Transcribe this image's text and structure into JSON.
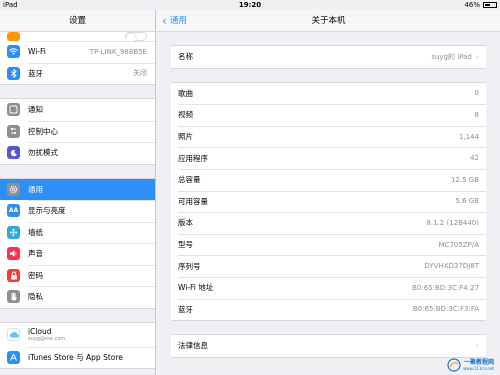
{
  "status_bar": {
    "device": "iPad",
    "time": "19:20",
    "battery": "46%",
    "battery_level": 0.46
  },
  "sidebar": {
    "title": "设置",
    "group1": [
      {
        "label": "Wi-Fi",
        "value": "TP-LINK_988B5E",
        "icon": "wifi-icon",
        "color": "#2d8ff6"
      },
      {
        "label": "蓝牙",
        "value": "关闭",
        "icon": "bluetooth-icon",
        "color": "#2d8ff6"
      }
    ],
    "group2": [
      {
        "label": "通知",
        "icon": "notification-icon",
        "color": "#8e8e93"
      },
      {
        "label": "控制中心",
        "icon": "control-center-icon",
        "color": "#8e8e93"
      },
      {
        "label": "勿扰模式",
        "icon": "do-not-disturb-icon",
        "color": "#5856d6"
      }
    ],
    "group3": [
      {
        "label": "通用",
        "icon": "gear-icon",
        "color": "#8e8e93",
        "selected": true
      },
      {
        "label": "显示与亮度",
        "icon": "brightness-icon",
        "color": "#2d8ff6"
      },
      {
        "label": "墙纸",
        "icon": "wallpaper-icon",
        "color": "#34aadc"
      },
      {
        "label": "声音",
        "icon": "sound-icon",
        "color": "#ff2d55"
      },
      {
        "label": "密码",
        "icon": "lock-icon",
        "color": "#ff3b30"
      },
      {
        "label": "隐私",
        "icon": "privacy-hand-icon",
        "color": "#8e8e93"
      }
    ],
    "group4": [
      {
        "label": "iCloud",
        "sub": "suyg@me.com",
        "icon": "icloud-icon",
        "color": "#ffffff"
      },
      {
        "label": "iTunes Store 与 App Store",
        "icon": "app-store-icon",
        "color": "#2d8ff6"
      }
    ]
  },
  "main": {
    "back_label": "通用",
    "title": "关于本机",
    "name_row": {
      "label": "名称",
      "value": "suyg的 iPad"
    },
    "info_rows": [
      {
        "label": "歌曲",
        "value": "0"
      },
      {
        "label": "视频",
        "value": "8"
      },
      {
        "label": "照片",
        "value": "1,144"
      },
      {
        "label": "应用程序",
        "value": "42"
      },
      {
        "label": "总容量",
        "value": "12.5 GB"
      },
      {
        "label": "可用容量",
        "value": "5.6 GB"
      },
      {
        "label": "版本",
        "value": "8.1.2 (12B440)"
      },
      {
        "label": "型号",
        "value": "MC705ZP/A"
      },
      {
        "label": "序列号",
        "value": "DYVHXD37DJ8T"
      },
      {
        "label": "Wi-Fi 地址",
        "value": "B0:65:BD:3C:F4:27"
      },
      {
        "label": "蓝牙",
        "value": "B0:65:BD:3C:F3:FA"
      }
    ],
    "legal_row": {
      "label": "法律信息"
    }
  },
  "watermark": {
    "text": "一聚教程网",
    "sub": "www.111cn.net"
  }
}
